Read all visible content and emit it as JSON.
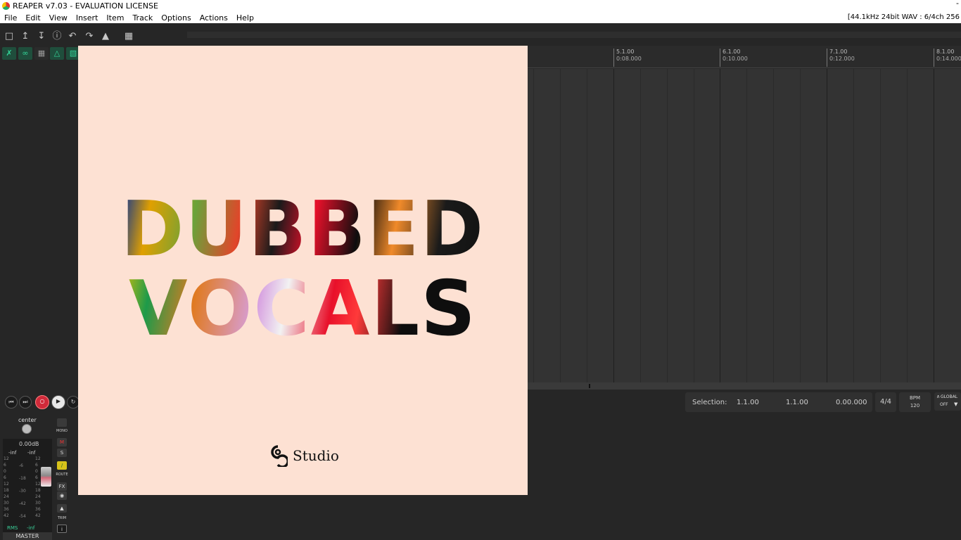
{
  "window": {
    "title": "REAPER v7.03 - EVALUATION LICENSE",
    "minimize_glyph": "-"
  },
  "menu": {
    "items": [
      "File",
      "Edit",
      "View",
      "Insert",
      "Item",
      "Track",
      "Options",
      "Actions",
      "Help"
    ],
    "format_info": "[44.1kHz 24bit WAV : 6/4ch 256"
  },
  "toolbar": {
    "icons": [
      "new-project-icon",
      "open-project-icon",
      "save-project-icon",
      "project-settings-icon",
      "undo-icon",
      "redo-icon",
      "metronome-icon",
      "grid-icon"
    ]
  },
  "ruler": {
    "marks": [
      {
        "bar": "5.1.00",
        "time": "0:08.000"
      },
      {
        "bar": "6.1.00",
        "time": "0:10.000"
      },
      {
        "bar": "7.1.00",
        "time": "0:12.000"
      },
      {
        "bar": "8.1.00",
        "time": "0:14.000"
      }
    ]
  },
  "transport": {
    "selection_label": "Selection:",
    "selection_start": "1.1.00",
    "selection_end": "1.1.00",
    "selection_length": "0.00.000",
    "time_signature": "4/4",
    "bpm_label": "BPM",
    "bpm_value": "120",
    "global_label": "GLOBAL",
    "global_state": "OFF"
  },
  "master": {
    "pan_label": "center",
    "volume": "0.00dB",
    "peak_left": "-inf",
    "peak_right": "-inf",
    "scale_left": [
      "12",
      "6",
      "0",
      "6",
      "12",
      "18",
      "24",
      "30",
      "36",
      "42"
    ],
    "scale_mid": [
      "-6",
      "-18",
      "-30",
      "-42",
      "-54"
    ],
    "scale_right": [
      "12",
      "6",
      "0",
      "6",
      "12",
      "18",
      "24",
      "30",
      "36",
      "42"
    ],
    "rms_label": "RMS",
    "rms_value": "-inf",
    "label": "MASTER",
    "mono_label": "MONO",
    "mute_label": "M",
    "solo_label": "S",
    "route_label": "ROUTE",
    "fx_label": "FX",
    "trim_label": "TRIM",
    "info_label": "i"
  },
  "cover": {
    "headline_line1": "DUBBED",
    "headline_line2": "VOCALS",
    "brand": "Studio"
  }
}
